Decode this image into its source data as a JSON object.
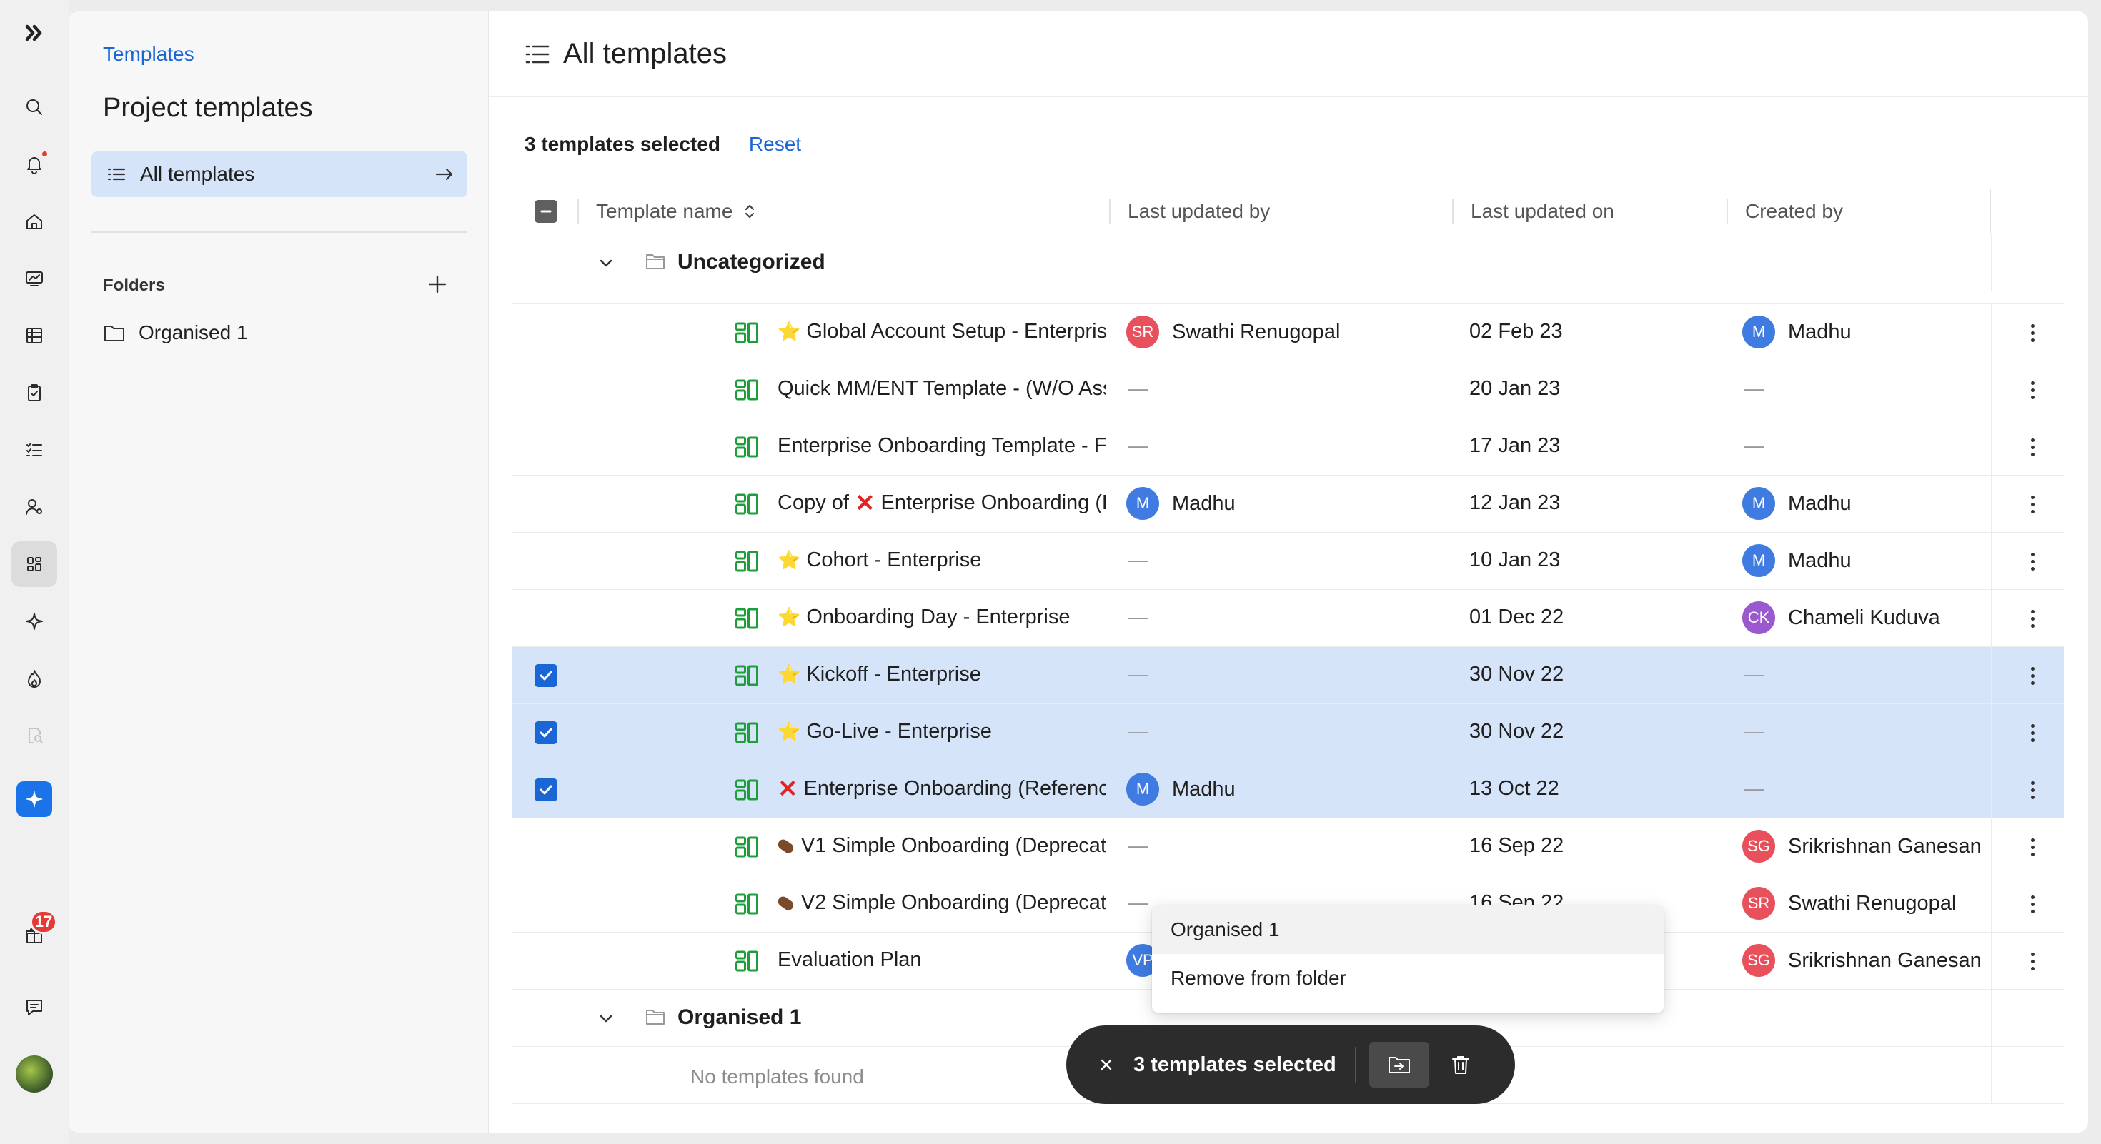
{
  "app": {
    "logo_icon": "double-chevron-logo"
  },
  "rail": {
    "items": [
      {
        "icon": "search-icon"
      },
      {
        "icon": "bell-icon",
        "has_dot": true
      },
      {
        "icon": "home-icon"
      },
      {
        "icon": "dashboard-icon"
      },
      {
        "icon": "table-icon"
      },
      {
        "icon": "clipboard-icon"
      },
      {
        "icon": "tasks-icon"
      },
      {
        "icon": "user-settings-icon"
      },
      {
        "icon": "templates-icon",
        "active": true
      },
      {
        "icon": "sparkle-icon"
      },
      {
        "icon": "flame-icon"
      },
      {
        "icon": "doc-search-icon"
      },
      {
        "icon": "ai-assistant-icon"
      }
    ],
    "gift_badge": "17"
  },
  "sidebar": {
    "breadcrumb": "Templates",
    "title": "Project templates",
    "all_templates_label": "All templates",
    "folders_heading": "Folders",
    "folders": [
      {
        "label": "Organised 1"
      }
    ]
  },
  "main": {
    "title": "All templates",
    "selection_count_label": "3 templates selected",
    "reset_label": "Reset",
    "columns": {
      "name": "Template name",
      "last_updated_by": "Last updated by",
      "last_updated_on": "Last updated on",
      "created_by": "Created by"
    },
    "groups": [
      {
        "name": "Uncategorized"
      },
      {
        "name": "Organised 1",
        "empty_label": "No templates found"
      }
    ],
    "rows": [
      {
        "emoji": "star",
        "name": "Global Account Setup - Enterpris",
        "updated_by": {
          "initials": "SR",
          "name": "Swathi Renugopal",
          "color": "#e8505b"
        },
        "updated_on": "02 Feb 23",
        "created_by": {
          "initials": "M",
          "name": "Madhu",
          "color": "#3f7be0"
        },
        "selected": false
      },
      {
        "emoji": "",
        "name": "Quick MM/ENT Template - (W/O Ass",
        "updated_by": null,
        "updated_on": "20 Jan 23",
        "created_by": null,
        "selected": false
      },
      {
        "emoji": "",
        "name": "Enterprise Onboarding Template - F",
        "updated_by": null,
        "updated_on": "17 Jan 23",
        "created_by": null,
        "selected": false
      },
      {
        "emoji": "",
        "prefix": "Copy of",
        "mid_emoji": "x",
        "name": "Enterprise Onboarding (F",
        "updated_by": {
          "initials": "M",
          "name": "Madhu",
          "color": "#3f7be0"
        },
        "updated_on": "12 Jan 23",
        "created_by": {
          "initials": "M",
          "name": "Madhu",
          "color": "#3f7be0"
        },
        "selected": false
      },
      {
        "emoji": "star",
        "name": "Cohort - Enterprise",
        "updated_by": null,
        "updated_on": "10 Jan 23",
        "created_by": {
          "initials": "M",
          "name": "Madhu",
          "color": "#3f7be0"
        },
        "selected": false
      },
      {
        "emoji": "star",
        "name": "Onboarding Day - Enterprise",
        "updated_by": null,
        "updated_on": "01 Dec 22",
        "created_by": {
          "initials": "CK",
          "name": "Chameli Kuduva",
          "color": "#9b59d0"
        },
        "selected": false
      },
      {
        "emoji": "star",
        "name": "Kickoff - Enterprise",
        "updated_by": null,
        "updated_on": "30 Nov 22",
        "created_by": null,
        "selected": true
      },
      {
        "emoji": "star",
        "name": "Go-Live - Enterprise",
        "updated_by": null,
        "updated_on": "30 Nov 22",
        "created_by": null,
        "selected": true
      },
      {
        "emoji": "x",
        "name": "Enterprise Onboarding (Referenc",
        "updated_by": {
          "initials": "M",
          "name": "Madhu",
          "color": "#3f7be0"
        },
        "updated_on": "13 Oct 22",
        "created_by": null,
        "selected": true
      },
      {
        "emoji": "sausage",
        "name": "V1 Simple Onboarding (Deprecat",
        "updated_by": null,
        "updated_on": "16 Sep 22",
        "created_by": {
          "initials": "SG",
          "name": "Srikrishnan Ganesan",
          "color": "#e8505b"
        },
        "selected": false
      },
      {
        "emoji": "sausage",
        "name": "V2 Simple Onboarding (Deprecat",
        "updated_by": null,
        "updated_on": "16 Sep 22",
        "created_by": {
          "initials": "SR",
          "name": "Swathi Renugopal",
          "color": "#e8505b"
        },
        "selected": false
      },
      {
        "emoji": "",
        "name": "Evaluation Plan",
        "updated_by": {
          "initials": "VP",
          "name": "",
          "color": "#3f7be0"
        },
        "updated_on": "",
        "created_by": {
          "initials": "SG",
          "name": "Srikrishnan Ganesan",
          "color": "#e8505b"
        },
        "selected": false
      }
    ],
    "dash": "—"
  },
  "folder_menu": {
    "items": [
      {
        "label": "Organised 1",
        "highlighted": true
      },
      {
        "label": "Remove from folder",
        "highlighted": false
      }
    ]
  },
  "toast": {
    "label": "3 templates selected",
    "close_icon": "close-icon",
    "move_icon": "move-to-folder-icon",
    "delete_icon": "trash-icon"
  },
  "colors": {
    "accent": "#1a66d6",
    "selected_row": "#d6e4fa",
    "template_icon": "#1e9e3a"
  }
}
